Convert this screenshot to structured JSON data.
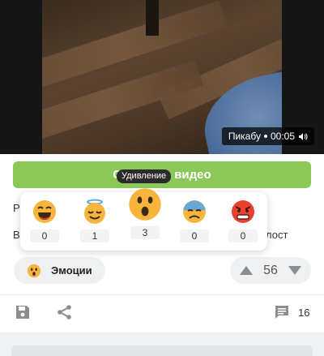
{
  "video": {
    "source": "Пикабу",
    "time": "00:05"
  },
  "green_button": {
    "label": "Смотреть видео"
  },
  "post_text": {
    "line1": "Р",
    "line2": "В",
    "line3": "лост"
  },
  "emotions": {
    "button_label": "Эмоции",
    "tooltip": "Удивление",
    "items": [
      {
        "name": "laughing",
        "count": "0"
      },
      {
        "name": "angel",
        "count": "1"
      },
      {
        "name": "surprised",
        "count": "3"
      },
      {
        "name": "anxious",
        "count": "0"
      },
      {
        "name": "angry",
        "count": "0"
      }
    ]
  },
  "rating": {
    "value": "56"
  },
  "toolbar": {
    "comments_count": "16"
  },
  "colors": {
    "accent_green": "#8ac858",
    "emoji_yellow": "#f8b43c",
    "angry_red": "#e8412f",
    "anxious_blue": "#6aa6d6"
  },
  "icons": {
    "save": "save-icon",
    "share": "share-icon",
    "comments": "comment-icon",
    "volume": "volume-icon",
    "upvote": "upvote-icon",
    "downvote": "downvote-icon"
  }
}
